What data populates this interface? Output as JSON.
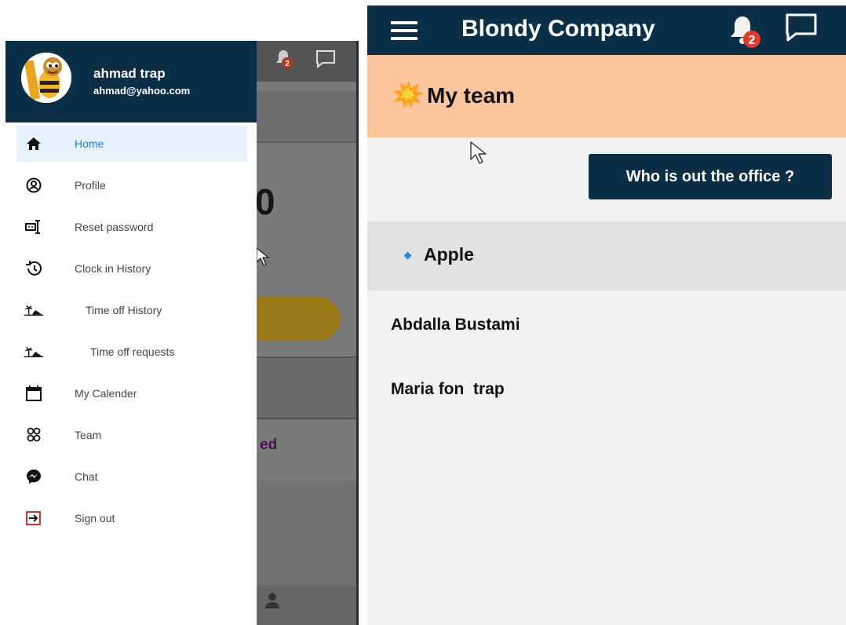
{
  "left_screen": {
    "drawer": {
      "user": {
        "name": "ahmad trap",
        "email": "ahmad@yahoo.com"
      },
      "menu": [
        {
          "label": "Home",
          "icon": "home-icon",
          "active": true
        },
        {
          "label": "Profile",
          "icon": "profile-icon"
        },
        {
          "label": "Reset password",
          "icon": "password-icon"
        },
        {
          "label": "Clock in History",
          "icon": "history-icon"
        },
        {
          "label": "Time off History",
          "icon": "beach-icon"
        },
        {
          "label": "Time off requests",
          "icon": "beach-icon"
        },
        {
          "label": "My Calender",
          "icon": "calendar-icon"
        },
        {
          "label": "Team",
          "icon": "team-icon"
        },
        {
          "label": "Chat",
          "icon": "messenger-icon"
        },
        {
          "label": "Sign out",
          "icon": "sign-out-icon"
        }
      ],
      "accent_color": "#1f7fd6",
      "header_color": "#0c2f48"
    },
    "background": {
      "notification_count": "2",
      "partial_digit": "0",
      "partial_text": "ed"
    }
  },
  "right_screen": {
    "app_title": "Blondy Company",
    "notification_count": "2",
    "section_title": "My team",
    "out_of_office_button": "Who is out the office ?",
    "group": {
      "name": "Apple"
    },
    "members": [
      "Abdalla Bustami",
      "Maria fon  trap"
    ],
    "colors": {
      "header": "#0c2f48",
      "section": "#fdc59d",
      "badge": "#e23b2e"
    }
  }
}
